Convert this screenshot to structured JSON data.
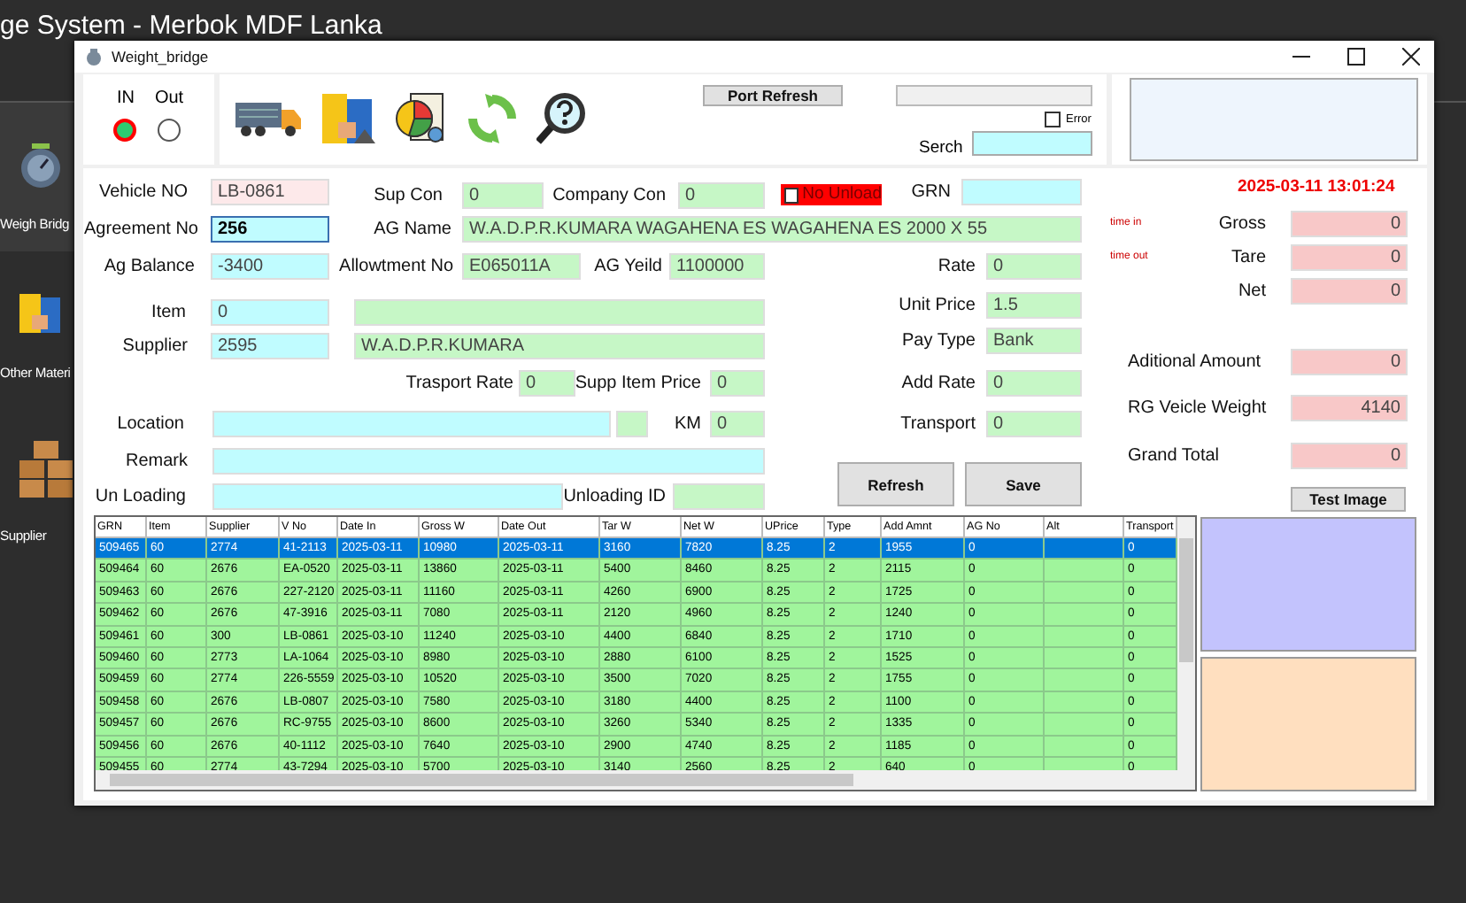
{
  "app": {
    "title": "ge System - Merbok MDF Lanka",
    "sidebar": [
      {
        "label": "Weigh Bridg",
        "selected": true
      },
      {
        "label": "Other Materi",
        "selected": false
      },
      {
        "label": "Supplier",
        "selected": false
      }
    ]
  },
  "window": {
    "title": "Weight_bridge"
  },
  "direction": [
    {
      "label": "IN",
      "selected": true
    },
    {
      "label": "Out",
      "selected": false
    }
  ],
  "toolbar": {
    "port_refresh": "Port Refresh",
    "error": {
      "label": "Error",
      "checked": false
    },
    "search": {
      "label": "Serch"
    }
  },
  "no_unload": {
    "label": "No Unload",
    "checked": false
  },
  "datetime": "2025-03-11 13:01:24",
  "time_in": "time in",
  "time_out": "time out",
  "fields": [
    {
      "label": "Vehicle NO",
      "value": "LB-0861",
      "color": "#fde9ea",
      "focused": false
    },
    {
      "label": "Sup Con",
      "value": "0",
      "color": "#c6f7c6",
      "focused": false
    },
    {
      "label": "Company Con",
      "value": "0",
      "color": "#c6f7c6",
      "focused": false
    },
    {
      "label": "GRN",
      "color": "#c0fcff",
      "focused": false
    },
    {
      "label": "Agreement No",
      "value": "256",
      "color": "#c0fcff",
      "focused": true
    },
    {
      "label": "AG Name",
      "value": "W.A.D.P.R.KUMARA WAGAHENA ES WAGAHENA ES 2000 X 55",
      "color": "#c6f7c6",
      "focused": false
    },
    {
      "label": "Ag Balance",
      "value": "-3400",
      "color": "#c0fcff",
      "focused": false
    },
    {
      "label": "Allowtment No",
      "value": "E065011A",
      "color": "#c6f7c6",
      "focused": false
    },
    {
      "label": "AG Yeild",
      "value": "1100000",
      "color": "#c6f7c6",
      "focused": false
    },
    {
      "label": "Rate",
      "value": "0",
      "color": "#c6f7c6",
      "focused": false
    },
    {
      "label": "Item",
      "value": "0",
      "color": "#c0fcff",
      "focused": false
    },
    {
      "color": "#c6f7c6",
      "focused": false
    },
    {
      "label": "Unit Price",
      "value": "1.5",
      "color": "#c6f7c6",
      "focused": false
    },
    {
      "label": "Supplier",
      "value": "2595",
      "color": "#c0fcff",
      "focused": false
    },
    {
      "value": "W.A.D.P.R.KUMARA",
      "color": "#c6f7c6",
      "focused": false
    },
    {
      "label": "Pay Type",
      "value": "Bank",
      "color": "#c6f7c6",
      "focused": false
    },
    {
      "label": "Trasport Rate",
      "value": "0",
      "color": "#c6f7c6",
      "focused": false
    },
    {
      "label": "Supp Item Price",
      "value": "0",
      "color": "#c6f7c6",
      "focused": false
    },
    {
      "label": "Add Rate",
      "value": "0",
      "color": "#c6f7c6",
      "focused": false
    },
    {
      "label": "Location",
      "color": "#c0fcff",
      "focused": false
    },
    {
      "color": "#c6f7c6",
      "focused": false
    },
    {
      "label": "KM",
      "value": "0",
      "color": "#c6f7c6",
      "focused": false
    },
    {
      "label": "Transport",
      "value": "0",
      "color": "#c6f7c6",
      "focused": false
    },
    {
      "label": "Remark",
      "color": "#c0fcff",
      "focused": false
    },
    {
      "label": "Un Loading",
      "color": "#c0fcff",
      "focused": false
    },
    {
      "label": "Unloading ID",
      "color": "#c6f7c6",
      "focused": false
    },
    {
      "label": "Gross",
      "value": "0",
      "color": "#f8c8c8",
      "focused": false
    },
    {
      "label": "Tare",
      "value": "0",
      "color": "#f8c8c8",
      "focused": false
    },
    {
      "label": "Net",
      "value": "0",
      "color": "#f8c8c8",
      "focused": false
    },
    {
      "label": "Aditional Amount",
      "value": "0",
      "color": "#f8c8c8",
      "focused": false
    },
    {
      "label": "RG Veicle Weight",
      "value": "4140",
      "color": "#f8c8c8",
      "focused": false
    },
    {
      "label": "Grand Total",
      "value": "0",
      "color": "#f8c8c8",
      "focused": false
    }
  ],
  "buttons": {
    "refresh": "Refresh",
    "save": "Save",
    "test_image": "Test Image"
  },
  "table": {
    "columns": [
      "GRN",
      "Item",
      "Supplier",
      "V No",
      "Date In",
      "Gross W",
      "Date Out",
      "Tar W",
      "Net W",
      "UPrice",
      "Type",
      "Add Amnt",
      "AG No",
      "Alt",
      "Transport"
    ],
    "rows": [
      {
        "selected": true,
        "cells": [
          "509465",
          "60",
          "2774",
          "41-2113",
          "2025-03-11",
          "10980",
          "2025-03-11",
          "3160",
          "7820",
          "8.25",
          "2",
          "1955",
          "0",
          null,
          "0"
        ]
      },
      {
        "selected": false,
        "cells": [
          "509464",
          "60",
          "2676",
          "EA-0520",
          "2025-03-11",
          "13860",
          "2025-03-11",
          "5400",
          "8460",
          "8.25",
          "2",
          "2115",
          "0",
          null,
          "0"
        ]
      },
      {
        "selected": false,
        "cells": [
          "509463",
          "60",
          "2676",
          "227-2120",
          "2025-03-11",
          "11160",
          "2025-03-11",
          "4260",
          "6900",
          "8.25",
          "2",
          "1725",
          "0",
          null,
          "0"
        ]
      },
      {
        "selected": false,
        "cells": [
          "509462",
          "60",
          "2676",
          "47-3916",
          "2025-03-11",
          "7080",
          "2025-03-11",
          "2120",
          "4960",
          "8.25",
          "2",
          "1240",
          "0",
          null,
          "0"
        ]
      },
      {
        "selected": false,
        "cells": [
          "509461",
          "60",
          "300",
          "LB-0861",
          "2025-03-10",
          "11240",
          "2025-03-10",
          "4400",
          "6840",
          "8.25",
          "2",
          "1710",
          "0",
          null,
          "0"
        ]
      },
      {
        "selected": false,
        "cells": [
          "509460",
          "60",
          "2773",
          "LA-1064",
          "2025-03-10",
          "8980",
          "2025-03-10",
          "2880",
          "6100",
          "8.25",
          "2",
          "1525",
          "0",
          null,
          "0"
        ]
      },
      {
        "selected": false,
        "cells": [
          "509459",
          "60",
          "2774",
          "226-5559",
          "2025-03-10",
          "10520",
          "2025-03-10",
          "3500",
          "7020",
          "8.25",
          "2",
          "1755",
          "0",
          null,
          "0"
        ]
      },
      {
        "selected": false,
        "cells": [
          "509458",
          "60",
          "2676",
          "LB-0807",
          "2025-03-10",
          "7580",
          "2025-03-10",
          "3180",
          "4400",
          "8.25",
          "2",
          "1100",
          "0",
          null,
          "0"
        ]
      },
      {
        "selected": false,
        "cells": [
          "509457",
          "60",
          "2676",
          "RC-9755",
          "2025-03-10",
          "8600",
          "2025-03-10",
          "3260",
          "5340",
          "8.25",
          "2",
          "1335",
          "0",
          null,
          "0"
        ]
      },
      {
        "selected": false,
        "cells": [
          "509456",
          "60",
          "2676",
          "40-1112",
          "2025-03-10",
          "7640",
          "2025-03-10",
          "2900",
          "4740",
          "8.25",
          "2",
          "1185",
          "0",
          null,
          "0"
        ]
      },
      {
        "selected": false,
        "cells": [
          "509455",
          "60",
          "2774",
          "43-7294",
          "2025-03-10",
          "5700",
          "2025-03-10",
          "3140",
          "2560",
          "8.25",
          "2",
          "640",
          "0",
          null,
          "0"
        ]
      }
    ]
  }
}
